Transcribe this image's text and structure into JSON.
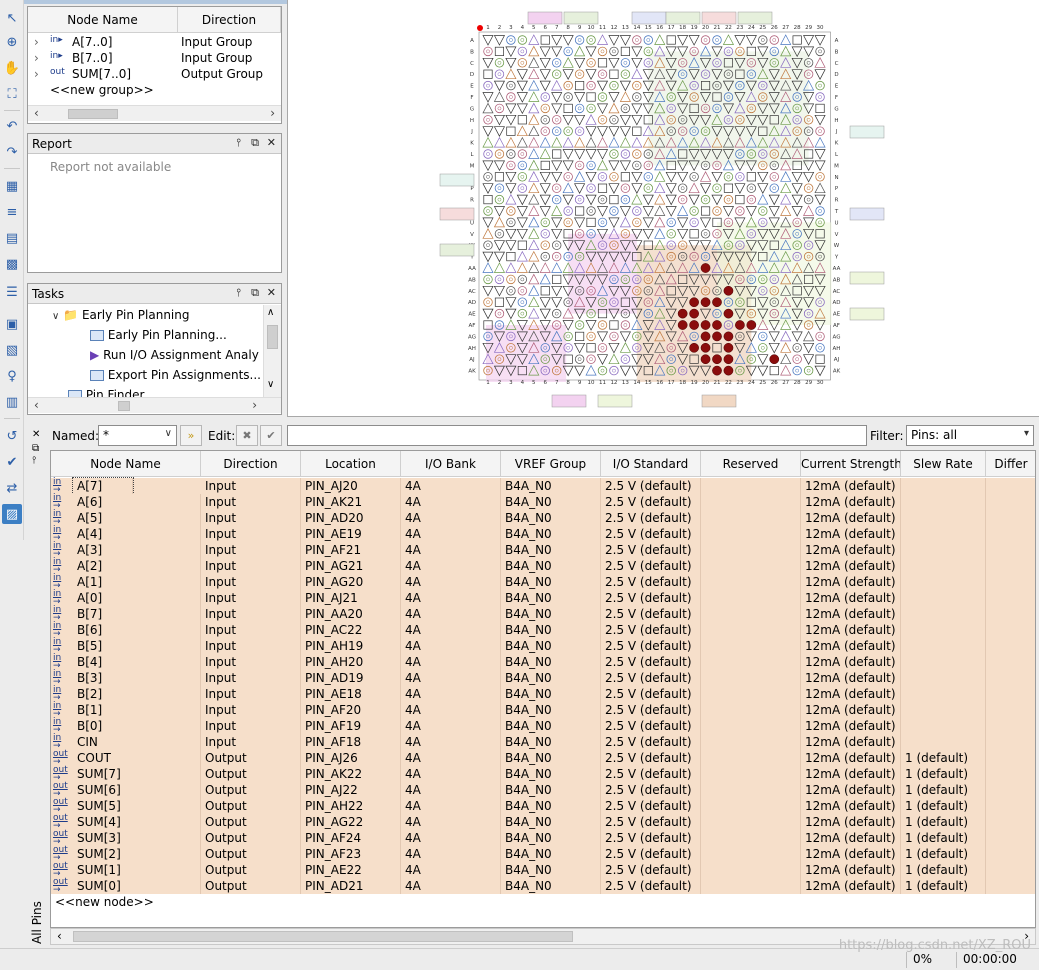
{
  "toolbar": {
    "icons": [
      "pointer-icon",
      "zoom-icon",
      "hand-icon",
      "fit-icon",
      "undo-icon",
      "redo-icon",
      "pin-planner-icon",
      "io-icon",
      "report-icon",
      "chip-icon",
      "list-icon",
      "pin-icon",
      "group-icon",
      "probe-icon",
      "package-icon",
      "back-icon",
      "check-icon",
      "io-bank-icon",
      "save-icon"
    ]
  },
  "groups": {
    "headers": [
      "Node Name",
      "Direction"
    ],
    "rows": [
      {
        "name": "A[7..0]",
        "direction": "Input Group",
        "dir": "in"
      },
      {
        "name": "B[7..0]",
        "direction": "Input Group",
        "dir": "in"
      },
      {
        "name": "SUM[7..0]",
        "direction": "Output Group",
        "dir": "out"
      }
    ],
    "new_group": "<<new group>>"
  },
  "report": {
    "title": "Report",
    "empty_text": "Report not available"
  },
  "tasks": {
    "title": "Tasks",
    "items": [
      {
        "label": "Early Pin Planning",
        "level": 1
      },
      {
        "label": "Early Pin Planning...",
        "level": 2
      },
      {
        "label": "Run I/O Assignment Analy",
        "level": 2
      },
      {
        "label": "Export Pin Assignments...",
        "level": 2
      },
      {
        "label": "Pin Finder",
        "level": 1
      }
    ]
  },
  "pin_view": {
    "columns": [
      "1",
      "2",
      "3",
      "4",
      "5",
      "6",
      "7",
      "8",
      "9",
      "10",
      "11",
      "12",
      "13",
      "14",
      "15",
      "16",
      "17",
      "18",
      "19",
      "20",
      "21",
      "22",
      "23",
      "24",
      "25",
      "26",
      "27",
      "28",
      "29",
      "30"
    ],
    "rows": [
      "A",
      "B",
      "C",
      "D",
      "E",
      "F",
      "G",
      "H",
      "J",
      "K",
      "L",
      "M",
      "N",
      "P",
      "R",
      "T",
      "U",
      "V",
      "W",
      "Y",
      "AA",
      "AB",
      "AC",
      "AD",
      "AE",
      "AF",
      "AG",
      "AH",
      "AJ",
      "AK"
    ]
  },
  "filter": {
    "named_label": "Named:",
    "named_value": "*",
    "edit_label": "Edit:",
    "filter_label": "Filter:",
    "filter_value": "Pins: all"
  },
  "side_tab": {
    "label": "All Pins"
  },
  "pins": {
    "headers": [
      "Node Name",
      "Direction",
      "Location",
      "I/O Bank",
      "VREF Group",
      "I/O Standard",
      "Reserved",
      "Current Strength",
      "Slew Rate",
      "Differ"
    ],
    "rows": [
      {
        "dir": "in",
        "name": "A[7]",
        "direction": "Input",
        "location": "PIN_AJ20",
        "bank": "4A",
        "vref": "B4A_N0",
        "std": "2.5 V (default)",
        "reserved": "",
        "current": "12mA (default)",
        "slew": ""
      },
      {
        "dir": "in",
        "name": "A[6]",
        "direction": "Input",
        "location": "PIN_AK21",
        "bank": "4A",
        "vref": "B4A_N0",
        "std": "2.5 V (default)",
        "reserved": "",
        "current": "12mA (default)",
        "slew": ""
      },
      {
        "dir": "in",
        "name": "A[5]",
        "direction": "Input",
        "location": "PIN_AD20",
        "bank": "4A",
        "vref": "B4A_N0",
        "std": "2.5 V (default)",
        "reserved": "",
        "current": "12mA (default)",
        "slew": ""
      },
      {
        "dir": "in",
        "name": "A[4]",
        "direction": "Input",
        "location": "PIN_AE19",
        "bank": "4A",
        "vref": "B4A_N0",
        "std": "2.5 V (default)",
        "reserved": "",
        "current": "12mA (default)",
        "slew": ""
      },
      {
        "dir": "in",
        "name": "A[3]",
        "direction": "Input",
        "location": "PIN_AF21",
        "bank": "4A",
        "vref": "B4A_N0",
        "std": "2.5 V (default)",
        "reserved": "",
        "current": "12mA (default)",
        "slew": ""
      },
      {
        "dir": "in",
        "name": "A[2]",
        "direction": "Input",
        "location": "PIN_AG21",
        "bank": "4A",
        "vref": "B4A_N0",
        "std": "2.5 V (default)",
        "reserved": "",
        "current": "12mA (default)",
        "slew": ""
      },
      {
        "dir": "in",
        "name": "A[1]",
        "direction": "Input",
        "location": "PIN_AG20",
        "bank": "4A",
        "vref": "B4A_N0",
        "std": "2.5 V (default)",
        "reserved": "",
        "current": "12mA (default)",
        "slew": ""
      },
      {
        "dir": "in",
        "name": "A[0]",
        "direction": "Input",
        "location": "PIN_AJ21",
        "bank": "4A",
        "vref": "B4A_N0",
        "std": "2.5 V (default)",
        "reserved": "",
        "current": "12mA (default)",
        "slew": ""
      },
      {
        "dir": "in",
        "name": "B[7]",
        "direction": "Input",
        "location": "PIN_AA20",
        "bank": "4A",
        "vref": "B4A_N0",
        "std": "2.5 V (default)",
        "reserved": "",
        "current": "12mA (default)",
        "slew": ""
      },
      {
        "dir": "in",
        "name": "B[6]",
        "direction": "Input",
        "location": "PIN_AC22",
        "bank": "4A",
        "vref": "B4A_N0",
        "std": "2.5 V (default)",
        "reserved": "",
        "current": "12mA (default)",
        "slew": ""
      },
      {
        "dir": "in",
        "name": "B[5]",
        "direction": "Input",
        "location": "PIN_AH19",
        "bank": "4A",
        "vref": "B4A_N0",
        "std": "2.5 V (default)",
        "reserved": "",
        "current": "12mA (default)",
        "slew": ""
      },
      {
        "dir": "in",
        "name": "B[4]",
        "direction": "Input",
        "location": "PIN_AH20",
        "bank": "4A",
        "vref": "B4A_N0",
        "std": "2.5 V (default)",
        "reserved": "",
        "current": "12mA (default)",
        "slew": ""
      },
      {
        "dir": "in",
        "name": "B[3]",
        "direction": "Input",
        "location": "PIN_AD19",
        "bank": "4A",
        "vref": "B4A_N0",
        "std": "2.5 V (default)",
        "reserved": "",
        "current": "12mA (default)",
        "slew": ""
      },
      {
        "dir": "in",
        "name": "B[2]",
        "direction": "Input",
        "location": "PIN_AE18",
        "bank": "4A",
        "vref": "B4A_N0",
        "std": "2.5 V (default)",
        "reserved": "",
        "current": "12mA (default)",
        "slew": ""
      },
      {
        "dir": "in",
        "name": "B[1]",
        "direction": "Input",
        "location": "PIN_AF20",
        "bank": "4A",
        "vref": "B4A_N0",
        "std": "2.5 V (default)",
        "reserved": "",
        "current": "12mA (default)",
        "slew": ""
      },
      {
        "dir": "in",
        "name": "B[0]",
        "direction": "Input",
        "location": "PIN_AF19",
        "bank": "4A",
        "vref": "B4A_N0",
        "std": "2.5 V (default)",
        "reserved": "",
        "current": "12mA (default)",
        "slew": ""
      },
      {
        "dir": "in",
        "name": "CIN",
        "direction": "Input",
        "location": "PIN_AF18",
        "bank": "4A",
        "vref": "B4A_N0",
        "std": "2.5 V (default)",
        "reserved": "",
        "current": "12mA (default)",
        "slew": ""
      },
      {
        "dir": "out",
        "name": "COUT",
        "direction": "Output",
        "location": "PIN_AJ26",
        "bank": "4A",
        "vref": "B4A_N0",
        "std": "2.5 V (default)",
        "reserved": "",
        "current": "12mA (default)",
        "slew": "1 (default)"
      },
      {
        "dir": "out",
        "name": "SUM[7]",
        "direction": "Output",
        "location": "PIN_AK22",
        "bank": "4A",
        "vref": "B4A_N0",
        "std": "2.5 V (default)",
        "reserved": "",
        "current": "12mA (default)",
        "slew": "1 (default)"
      },
      {
        "dir": "out",
        "name": "SUM[6]",
        "direction": "Output",
        "location": "PIN_AJ22",
        "bank": "4A",
        "vref": "B4A_N0",
        "std": "2.5 V (default)",
        "reserved": "",
        "current": "12mA (default)",
        "slew": "1 (default)"
      },
      {
        "dir": "out",
        "name": "SUM[5]",
        "direction": "Output",
        "location": "PIN_AH22",
        "bank": "4A",
        "vref": "B4A_N0",
        "std": "2.5 V (default)",
        "reserved": "",
        "current": "12mA (default)",
        "slew": "1 (default)"
      },
      {
        "dir": "out",
        "name": "SUM[4]",
        "direction": "Output",
        "location": "PIN_AG22",
        "bank": "4A",
        "vref": "B4A_N0",
        "std": "2.5 V (default)",
        "reserved": "",
        "current": "12mA (default)",
        "slew": "1 (default)"
      },
      {
        "dir": "out",
        "name": "SUM[3]",
        "direction": "Output",
        "location": "PIN_AF24",
        "bank": "4A",
        "vref": "B4A_N0",
        "std": "2.5 V (default)",
        "reserved": "",
        "current": "12mA (default)",
        "slew": "1 (default)"
      },
      {
        "dir": "out",
        "name": "SUM[2]",
        "direction": "Output",
        "location": "PIN_AF23",
        "bank": "4A",
        "vref": "B4A_N0",
        "std": "2.5 V (default)",
        "reserved": "",
        "current": "12mA (default)",
        "slew": "1 (default)"
      },
      {
        "dir": "out",
        "name": "SUM[1]",
        "direction": "Output",
        "location": "PIN_AE22",
        "bank": "4A",
        "vref": "B4A_N0",
        "std": "2.5 V (default)",
        "reserved": "",
        "current": "12mA (default)",
        "slew": "1 (default)"
      },
      {
        "dir": "out",
        "name": "SUM[0]",
        "direction": "Output",
        "location": "PIN_AD21",
        "bank": "4A",
        "vref": "B4A_N0",
        "std": "2.5 V (default)",
        "reserved": "",
        "current": "12mA (default)",
        "slew": "1 (default)"
      }
    ],
    "new_node": "<<new node>>"
  },
  "status": {
    "progress": "0%",
    "time": "00:00:00"
  },
  "watermark": "https://blog.csdn.net/XZ_ROU"
}
